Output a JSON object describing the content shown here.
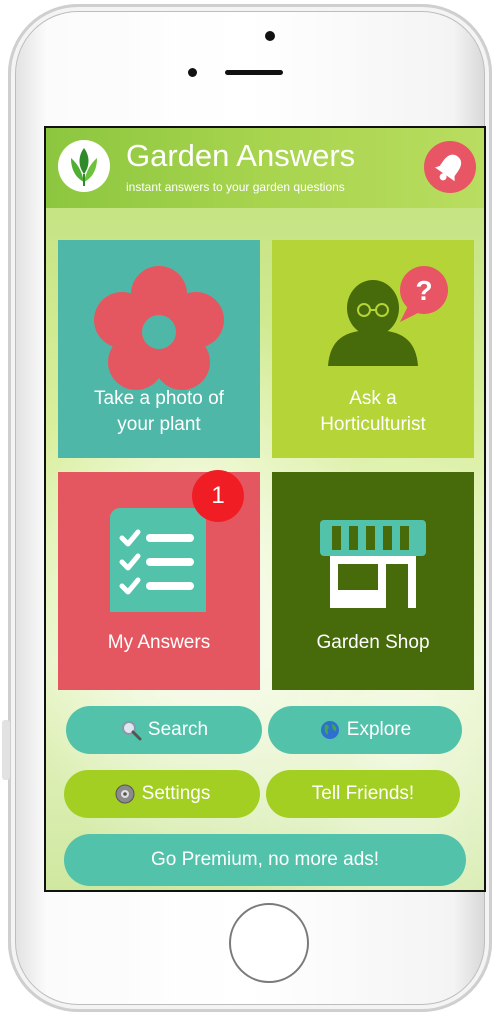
{
  "app": {
    "title": "Garden Answers",
    "subtitle": "instant answers to your garden questions"
  },
  "tiles": [
    {
      "name": "take-photo",
      "line1": "Take a photo of",
      "line2": "your plant",
      "color": "#4fb7a8"
    },
    {
      "name": "ask-horticulturist",
      "line1": "Ask a",
      "line2": "Horticulturist",
      "color": "#b4d437"
    },
    {
      "name": "my-answers",
      "label": "My Answers",
      "color": "#e55760",
      "badge": "1"
    },
    {
      "name": "garden-shop",
      "label": "Garden Shop",
      "color": "#476a0a"
    }
  ],
  "buttons": {
    "search": "Search",
    "explore": "Explore",
    "settings": "Settings",
    "tell_friends": "Tell Friends!",
    "premium": "Go Premium, no more ads!"
  },
  "icons": {
    "search": "magnifier-icon",
    "explore": "globe-icon",
    "settings": "gear-icon",
    "notifications": "bell-icon"
  },
  "colors": {
    "teal": "#52c2ab",
    "lime": "#a3cf23",
    "red": "#e55760",
    "dark_green": "#476a0a",
    "badge": "#f01e24"
  }
}
